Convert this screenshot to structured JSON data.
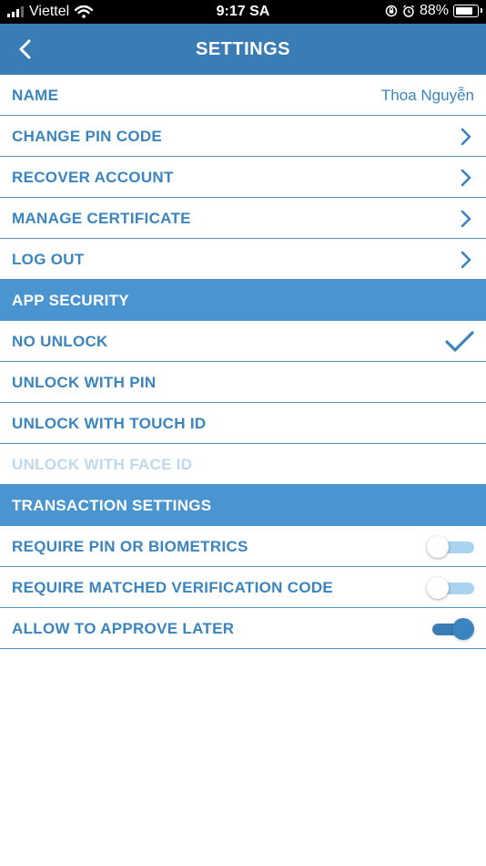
{
  "status_bar": {
    "carrier": "Viettel",
    "time": "9:17 SA",
    "battery_percent": "88%",
    "battery_level": 0.88,
    "icons": [
      "signal-icon",
      "wifi-icon",
      "orientation-lock-icon",
      "alarm-icon",
      "battery-icon"
    ]
  },
  "header": {
    "title": "SETTINGS",
    "back_icon": "chevron-left-icon"
  },
  "account": {
    "name_label": "NAME",
    "name_value": "Thoa Nguyễn",
    "change_pin": "CHANGE PIN CODE",
    "recover": "RECOVER ACCOUNT",
    "certificate": "MANAGE CERTIFICATE",
    "logout": "LOG OUT"
  },
  "app_security": {
    "title": "APP SECURITY",
    "no_unlock": "NO UNLOCK",
    "unlock_pin": "UNLOCK WITH PIN",
    "unlock_touch": "UNLOCK WITH TOUCH ID",
    "unlock_face": "UNLOCK WITH FACE ID",
    "selected": "NO UNLOCK",
    "disabled": "UNLOCK WITH FACE ID"
  },
  "transaction": {
    "title": "TRANSACTION SETTINGS",
    "require_pin": "REQUIRE PIN OR BIOMETRICS",
    "require_pin_on": false,
    "require_code": "REQUIRE MATCHED VERIFICATION CODE",
    "require_code_on": false,
    "approve_later": "ALLOW TO APPROVE LATER",
    "approve_later_on": true
  },
  "colors": {
    "header_bg": "#3a7cb6",
    "section_bg": "#4a95d0",
    "text_accent": "#3a84bf",
    "disabled_text": "#bfd8ec",
    "toggle_track_off": "#a8d3f1"
  }
}
